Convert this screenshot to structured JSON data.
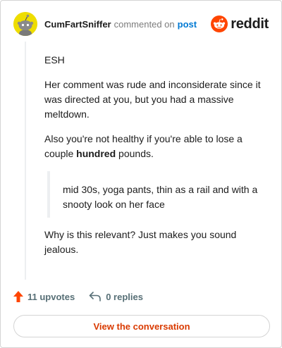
{
  "header": {
    "username": "CumFartSniffer",
    "action_text": "commented on",
    "post_link": "post",
    "brand": "reddit",
    "avatar_color": "#eedd00"
  },
  "comment": {
    "p1": "ESH",
    "p2": "Her comment was rude and inconsiderate since it was directed at you, but you had a massive meltdown.",
    "p3_before": "Also you're not healthy if you're able to lose a couple ",
    "p3_bold": "hundred",
    "p3_after": " pounds.",
    "quote": "mid 30s, yoga pants, thin as a rail and with a snooty look on her face",
    "p4": "Why is this relevant? Just makes you sound jealous."
  },
  "footer": {
    "upvotes": "11 upvotes",
    "replies": "0 replies",
    "upvote_color": "#ff4500"
  },
  "cta": {
    "label": "View the conversation",
    "color": "#d93a00"
  }
}
